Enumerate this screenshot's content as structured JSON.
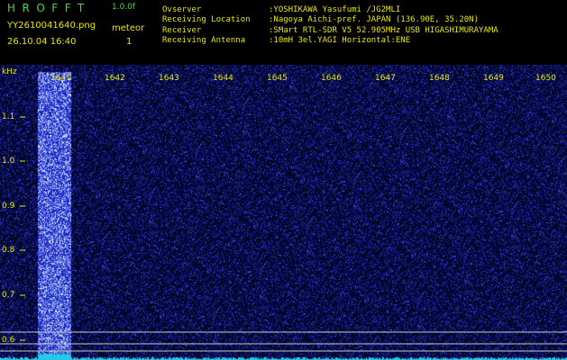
{
  "header": {
    "app_name": "HROFFT",
    "version": "1.0.0f",
    "filename": "YY2610041640.png",
    "meteor_label": "meteor",
    "datetime": "26.10.04 16:40",
    "meteor_count": "1",
    "info": [
      {
        "key": "Ovserver",
        "value": ":YOSHIKAWA Yasufumi /JG2MLI"
      },
      {
        "key": "Receiving Location",
        "value": ":Nagoya Aichi-pref. JAPAN (136.90E, 35.20N)"
      },
      {
        "key": "Receiver",
        "value": ":SMart RTL-SDR V5 52.905MHz USB HIGASHIMURAYAMA"
      },
      {
        "key": "Receiving Antenna",
        "value": ":10mH 3el.YAGI Horizontal:ENE"
      }
    ]
  },
  "spectrogram": {
    "y_unit": "kHz",
    "y_ticks": [
      "1.1",
      "1.0",
      "0.9",
      "0.8",
      "0.7",
      "0.6"
    ],
    "x_ticks": [
      "1641",
      "1642",
      "1643",
      "1644",
      "1645",
      "1646",
      "1647",
      "1648",
      "1649",
      "1650"
    ],
    "colors": {
      "noise_bg": "#000a32",
      "noise": "#1a1fb0",
      "signal": "#7fa6ff",
      "signal_hot": "#ffffff",
      "trace": "#27c7e8",
      "label": "#e8e800"
    }
  }
}
